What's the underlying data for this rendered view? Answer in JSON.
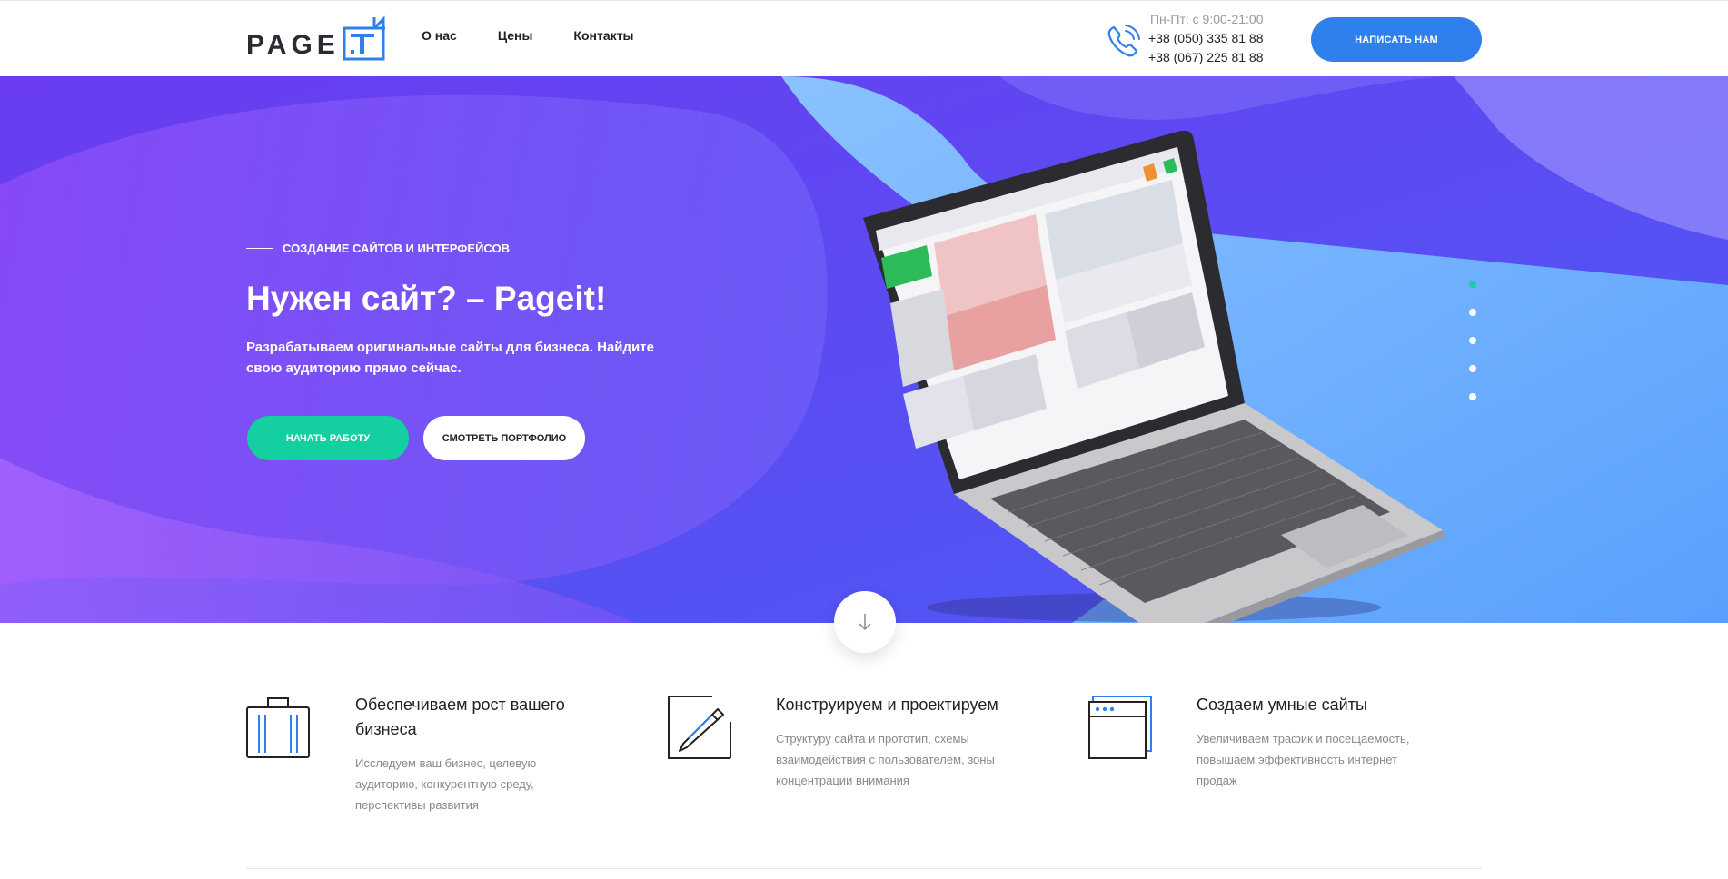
{
  "brand": {
    "logo_text": "PAGE"
  },
  "nav": {
    "items": [
      "О нас",
      "Цены",
      "Контакты"
    ]
  },
  "contact": {
    "hours": "Пн-Пт: с 9:00-21:00",
    "phone1": "+38 (050) 335 81 88",
    "phone2": "+38 (067) 225 81 88"
  },
  "header_cta": "НАПИСАТЬ НАМ",
  "hero": {
    "kicker": "СОЗДАНИЕ САЙТОВ И ИНТЕРФЕЙСОВ",
    "title": "Нужен сайт? – Pageit!",
    "description": "Разрабатываем оригинальные сайты для бизнеса. Найдите свою аудиторию прямо сейчас.",
    "btn_start": "НАЧАТЬ РАБОТУ",
    "btn_portfolio": "СМОТРЕТЬ ПОРТФОЛИО",
    "slides_count": 5,
    "active_slide": 1
  },
  "features": [
    {
      "icon": "suitcase-icon",
      "title": "Обеспечиваем рост вашего бизнеса",
      "desc": "Исследуем ваш бизнес, целевую аудиторию, конкурентную среду, перспективы развития"
    },
    {
      "icon": "pencil-icon",
      "title": "Конструируем и проектируем",
      "desc": "Структуру сайта и прототип, схемы взаимодействия с пользователем, зоны концентрации внимания"
    },
    {
      "icon": "browser-window-icon",
      "title": "Создаем умные сайты",
      "desc": "Увеличиваем трафик и посещаемость, повышаем эффективность интернет продаж"
    }
  ],
  "colors": {
    "accent_blue": "#2f80ed",
    "accent_green": "#14d0a0",
    "hero_purple": "#5a48f0"
  }
}
